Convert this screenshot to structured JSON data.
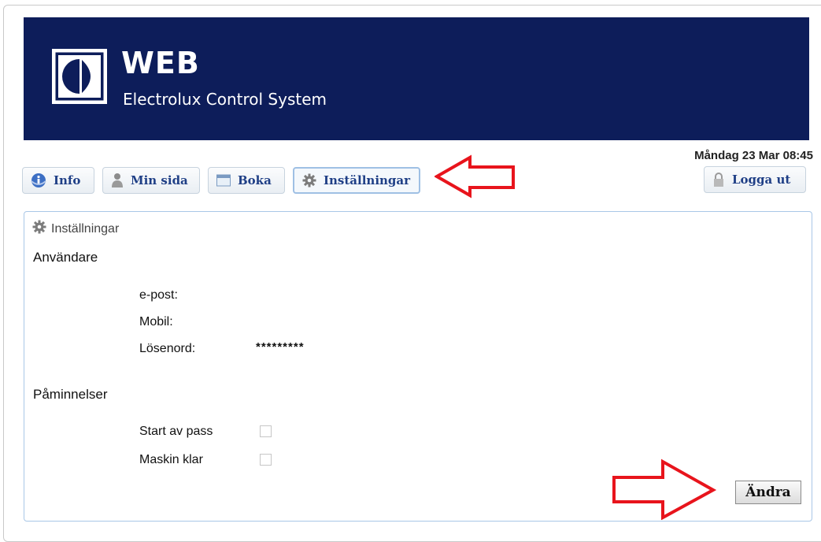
{
  "header": {
    "brand_title": "WEB",
    "brand_subtitle": "Electrolux Control System",
    "background_color": "#0d1d5a"
  },
  "datetime": "Måndag 23 Mar 08:45",
  "nav": {
    "items": [
      {
        "label": "Info",
        "icon": "info-icon"
      },
      {
        "label": "Min sida",
        "icon": "person-icon"
      },
      {
        "label": "Boka",
        "icon": "calendar-icon"
      },
      {
        "label": "Inställningar",
        "icon": "gear-icon",
        "active": true
      }
    ],
    "logout_label": "Logga ut",
    "logout_icon": "lock-icon"
  },
  "panel": {
    "title": "Inställningar",
    "user_section": "Användare",
    "fields": [
      {
        "label": "e-post:",
        "value": ""
      },
      {
        "label": "Mobil:",
        "value": ""
      },
      {
        "label": "Lösenord:",
        "value": "*********"
      }
    ],
    "reminder_section": "Påminnelser",
    "reminders": [
      {
        "label": "Start av pass",
        "checked": false
      },
      {
        "label": "Maskin klar",
        "checked": false
      }
    ],
    "edit_button": "Ändra"
  },
  "annotation_color": "#e8141c"
}
